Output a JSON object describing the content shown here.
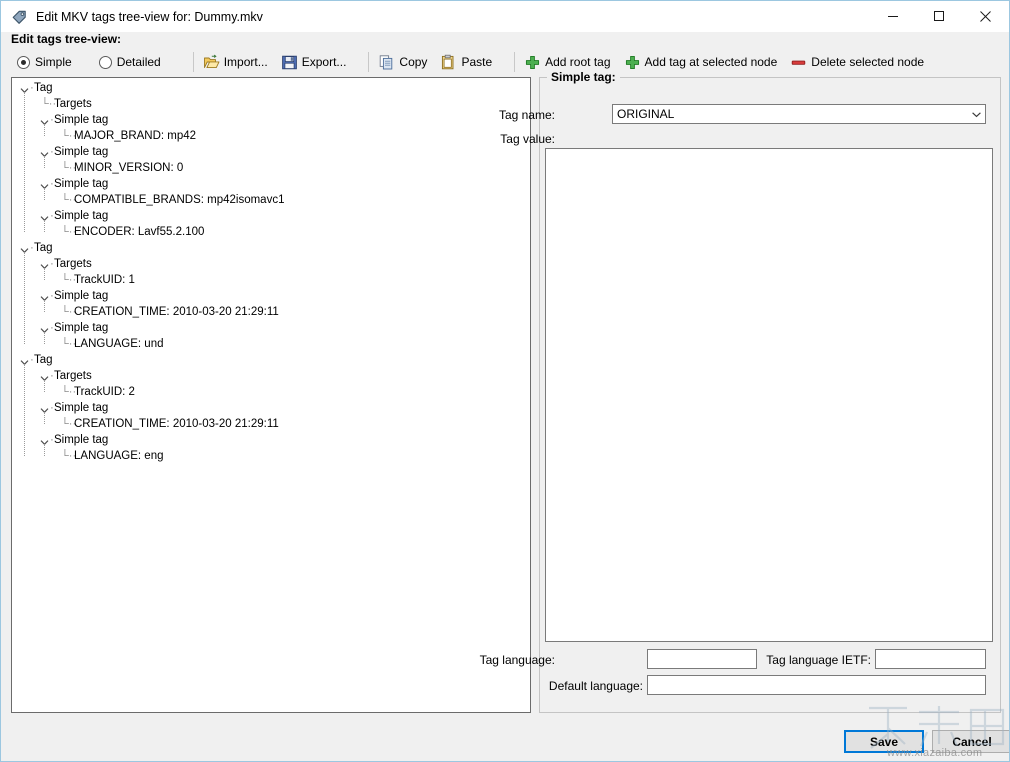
{
  "window": {
    "title": "Edit MKV tags tree-view for: Dummy.mkv",
    "app_icon": "tag-icon",
    "minimize_label": "─",
    "maximize_label": "□",
    "close_label": "✕",
    "accent": "#0078d7",
    "background": "#f0f0f0",
    "border_color": "#9cc7e0"
  },
  "toolbar": {
    "section_label": "Edit tags tree-view:",
    "view_modes": [
      {
        "label": "Simple",
        "checked": true
      },
      {
        "label": "Detailed",
        "checked": false
      }
    ],
    "actions": [
      {
        "label": "Import...",
        "icon": "open-folder-icon"
      },
      {
        "label": "Export...",
        "icon": "floppy-save-icon"
      },
      {
        "label": "Copy",
        "icon": "copy-pages-icon"
      },
      {
        "label": "Paste",
        "icon": "clipboard-paste-icon"
      },
      {
        "label": "Add root tag",
        "icon": "green-plus-icon"
      },
      {
        "label": "Add tag at selected node",
        "icon": "green-plus-icon"
      },
      {
        "label": "Delete selected node",
        "icon": "red-minus-icon"
      }
    ]
  },
  "tree": {
    "nodes": [
      {
        "depth": 0,
        "label": "Tag",
        "expander": "expanded"
      },
      {
        "depth": 1,
        "label": "Targets",
        "expander": "leaf"
      },
      {
        "depth": 1,
        "label": "Simple tag",
        "expander": "expanded"
      },
      {
        "depth": 2,
        "label": "MAJOR_BRAND: mp42",
        "expander": "leaf"
      },
      {
        "depth": 1,
        "label": "Simple tag",
        "expander": "expanded"
      },
      {
        "depth": 2,
        "label": "MINOR_VERSION: 0",
        "expander": "leaf"
      },
      {
        "depth": 1,
        "label": "Simple tag",
        "expander": "expanded"
      },
      {
        "depth": 2,
        "label": "COMPATIBLE_BRANDS: mp42isomavc1",
        "expander": "leaf"
      },
      {
        "depth": 1,
        "label": "Simple tag",
        "expander": "expanded"
      },
      {
        "depth": 2,
        "label": "ENCODER: Lavf55.2.100",
        "expander": "leaf"
      },
      {
        "depth": 0,
        "label": "Tag",
        "expander": "expanded"
      },
      {
        "depth": 1,
        "label": "Targets",
        "expander": "expanded"
      },
      {
        "depth": 2,
        "label": "TrackUID: 1",
        "expander": "leaf"
      },
      {
        "depth": 1,
        "label": "Simple tag",
        "expander": "expanded"
      },
      {
        "depth": 2,
        "label": "CREATION_TIME: 2010-03-20 21:29:11",
        "expander": "leaf"
      },
      {
        "depth": 1,
        "label": "Simple tag",
        "expander": "expanded"
      },
      {
        "depth": 2,
        "label": "LANGUAGE: und",
        "expander": "leaf"
      },
      {
        "depth": 0,
        "label": "Tag",
        "expander": "expanded"
      },
      {
        "depth": 1,
        "label": "Targets",
        "expander": "expanded"
      },
      {
        "depth": 2,
        "label": "TrackUID: 2",
        "expander": "leaf"
      },
      {
        "depth": 1,
        "label": "Simple tag",
        "expander": "expanded"
      },
      {
        "depth": 2,
        "label": "CREATION_TIME: 2010-03-20 21:29:11",
        "expander": "leaf"
      },
      {
        "depth": 1,
        "label": "Simple tag",
        "expander": "expanded"
      },
      {
        "depth": 2,
        "label": "LANGUAGE: eng",
        "expander": "leaf"
      }
    ]
  },
  "details": {
    "group_title": "Simple tag:",
    "tag_name_label": "Tag name:",
    "tag_name_value": "ORIGINAL",
    "tag_name_placeholder": "",
    "tag_value_label": "Tag value:",
    "tag_value_text": "",
    "tag_value_placeholder": "",
    "tag_language_label": "Tag language:",
    "tag_language_value": "",
    "tag_language_ietf_label": "Tag language IETF:",
    "tag_language_ietf_value": "",
    "default_language_label": "Default language:",
    "default_language_value": ""
  },
  "footer": {
    "save_label": "Save",
    "cancel_label": "Cancel"
  },
  "watermark": {
    "text_cn": "下载吧",
    "url": "www.xiazaiba.com"
  }
}
